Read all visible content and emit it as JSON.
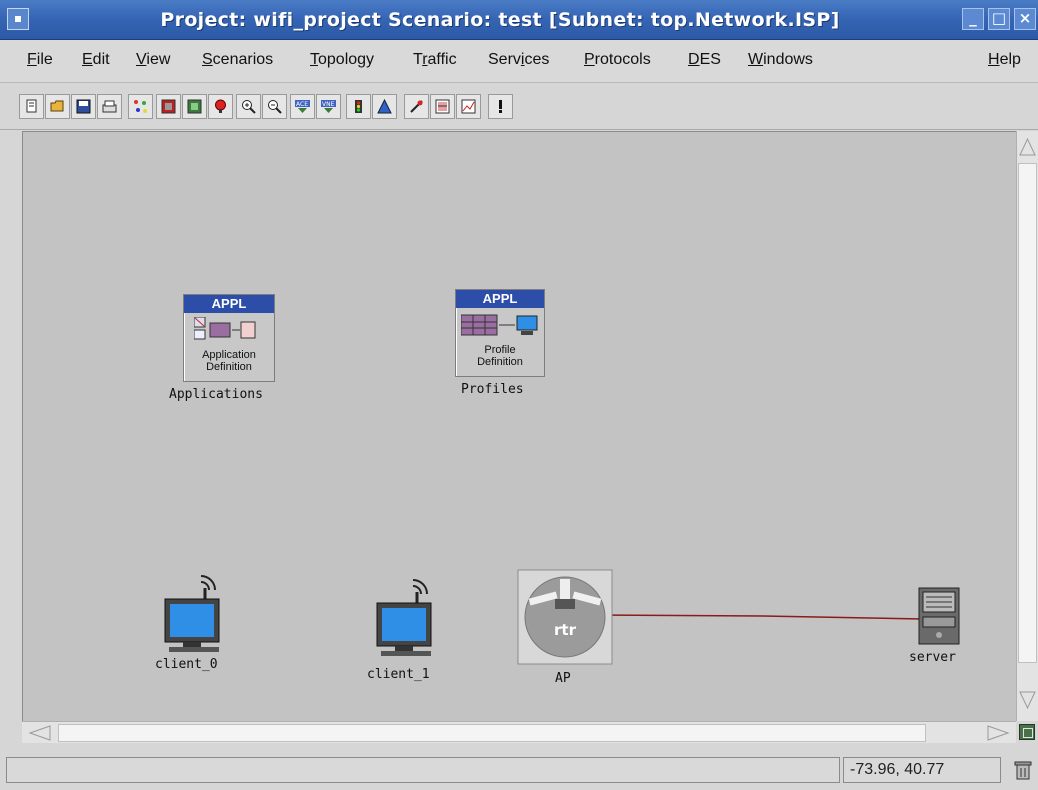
{
  "window": {
    "title": "Project: wifi_project Scenario: test  [Subnet: top.Network.ISP]",
    "minimize_glyph": "_",
    "maximize_glyph": "□",
    "close_glyph": "×"
  },
  "menu": {
    "items": [
      {
        "pre": "",
        "ul": "F",
        "post": "ile"
      },
      {
        "pre": "",
        "ul": "E",
        "post": "dit"
      },
      {
        "pre": "",
        "ul": "V",
        "post": "iew"
      },
      {
        "pre": "",
        "ul": "S",
        "post": "cenarios"
      },
      {
        "pre": "",
        "ul": "T",
        "post": "opology"
      },
      {
        "pre": "T",
        "ul": "r",
        "post": "affic"
      },
      {
        "pre": "Serv",
        "ul": "i",
        "post": "ces"
      },
      {
        "pre": "",
        "ul": "P",
        "post": "rotocols"
      },
      {
        "pre": "",
        "ul": "D",
        "post": "ES"
      },
      {
        "pre": "",
        "ul": "W",
        "post": "indows"
      },
      {
        "pre": "",
        "ul": "H",
        "post": "elp"
      }
    ]
  },
  "toolbar": {
    "tools": [
      "new-project-icon",
      "open-folder-icon",
      "save-icon",
      "print-icon",
      "node-palette-icon",
      "configure-node-icon",
      "check-links-icon",
      "fail-node-icon",
      "zoom-in-icon",
      "zoom-out-icon",
      "ace-import-icon",
      "vne-import-icon",
      "run-simulation-icon",
      "view-results-icon",
      "hide-statistics-icon",
      "edit-attributes-icon",
      "web-reports-icon",
      "info-icon"
    ],
    "tool_texts": {
      "ace": "ACE",
      "vne": "VNE"
    }
  },
  "nodes": {
    "applications": {
      "header": "APPL",
      "caption_line1": "Application",
      "caption_line2": "Definition",
      "label": "Applications"
    },
    "profiles": {
      "header": "APPL",
      "caption_line1": "Profile",
      "caption_line2": "Definition",
      "label": "Profiles"
    },
    "client0": {
      "label": "client_0"
    },
    "client1": {
      "label": "client_1"
    },
    "ap": {
      "label": "AP",
      "icon_text": "rtr"
    },
    "server": {
      "label": "server"
    }
  },
  "status": {
    "message": "",
    "coordinates": "-73.96, 40.77"
  },
  "colors": {
    "title_bar": "#3464b3",
    "workspace": "#c3c3c3",
    "link": "#8b1a1a",
    "appl_header": "#2c4ea8",
    "monitor_screen": "#2f8fe6"
  }
}
